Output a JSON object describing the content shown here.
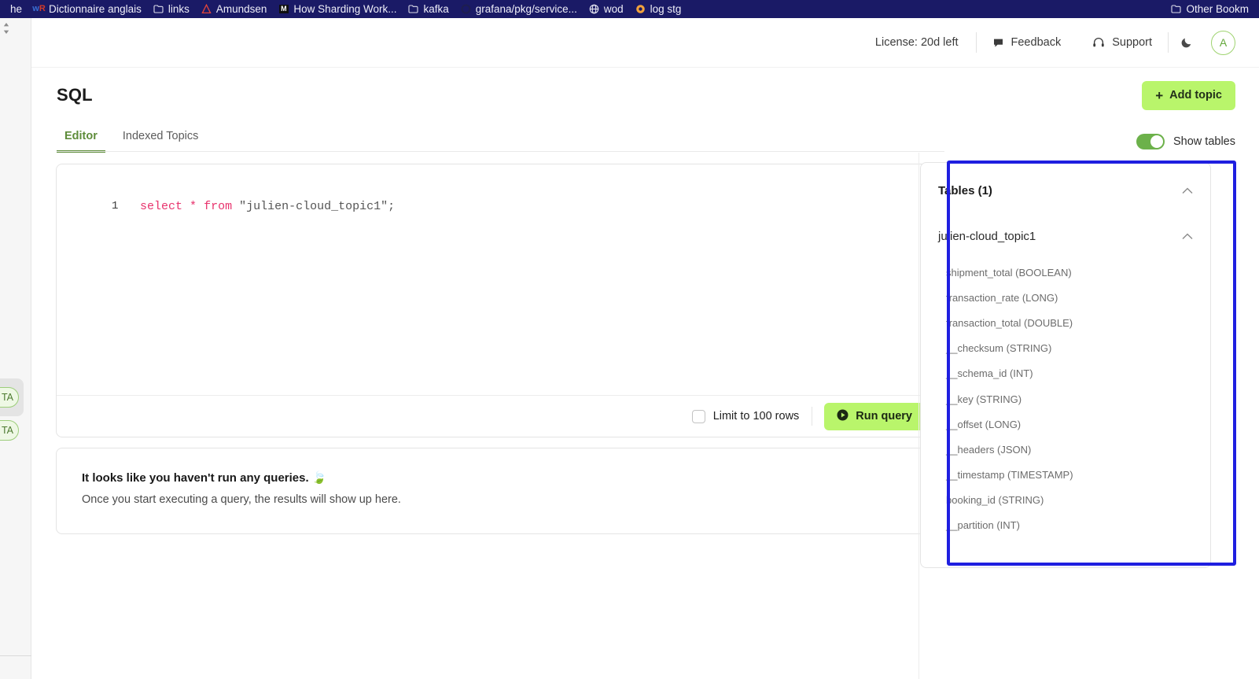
{
  "browser": {
    "bookmarks": [
      {
        "label": "he",
        "icon": "none"
      },
      {
        "label": "Dictionnaire anglais",
        "icon": "wordreference-icon"
      },
      {
        "label": "links",
        "icon": "folder-icon"
      },
      {
        "label": "Amundsen",
        "icon": "amundsen-icon"
      },
      {
        "label": "How Sharding Work...",
        "icon": "medium-icon"
      },
      {
        "label": "kafka",
        "icon": "folder-icon"
      },
      {
        "label": "grafana/pkg/service...",
        "icon": "grafana-icon"
      },
      {
        "label": "wod",
        "icon": "globe-icon"
      },
      {
        "label": "log stg",
        "icon": "kibana-icon"
      }
    ],
    "other_bookmarks": {
      "label": "Other Bookm",
      "icon": "folder-icon"
    }
  },
  "left_rail": {
    "collapse_handle_icon": "chevron-up-down-icon",
    "chips": [
      {
        "label": "TA"
      },
      {
        "label": "TA"
      }
    ]
  },
  "header": {
    "license": "License: 20d left",
    "feedback": {
      "label": "Feedback",
      "icon": "chat-bubble-icon"
    },
    "support": {
      "label": "Support",
      "icon": "headset-icon"
    },
    "theme_toggle_icon": "moon-icon",
    "avatar": {
      "initial": "A",
      "accent": "#9ed36f"
    }
  },
  "title_bar": {
    "title": "SQL",
    "add_topic": {
      "plus": "+",
      "label": "Add topic",
      "color": "#b9f56b"
    }
  },
  "tabs": {
    "items": [
      {
        "label": "Editor",
        "active": true
      },
      {
        "label": "Indexed Topics",
        "active": false
      }
    ],
    "active_color": "#5e8c3a",
    "show_tables": {
      "label": "Show tables",
      "enabled": true,
      "on_color": "#6cb14a"
    }
  },
  "editor": {
    "line_number": "1",
    "code": {
      "kw_select": "select",
      "op_star": "*",
      "kw_from": "from",
      "string": "\"julien-cloud_topic1\";"
    },
    "limit_rows": {
      "label": "Limit to 100 rows",
      "checked": false
    },
    "run_query": {
      "label": "Run query",
      "icon": "play-icon",
      "color": "#b9f56b"
    }
  },
  "results": {
    "empty_title": "It looks like you haven't run any queries. 🍃",
    "empty_subtitle": "Once you start executing a query, the results will show up here."
  },
  "tables_panel": {
    "header": "Tables (1)",
    "header_chevron_icon": "chevron-up-icon",
    "table_name": "julien-cloud_topic1",
    "table_chevron_icon": "chevron-up-icon",
    "columns": [
      "shipment_total (BOOLEAN)",
      "transaction_rate (LONG)",
      "transaction_total (DOUBLE)",
      "__checksum (STRING)",
      "__schema_id (INT)",
      "__key (STRING)",
      "__offset (LONG)",
      "__headers (JSON)",
      "__timestamp (TIMESTAMP)",
      "booking_id (STRING)",
      "__partition (INT)"
    ]
  },
  "annotation": {
    "color": "#1f1fe0"
  }
}
